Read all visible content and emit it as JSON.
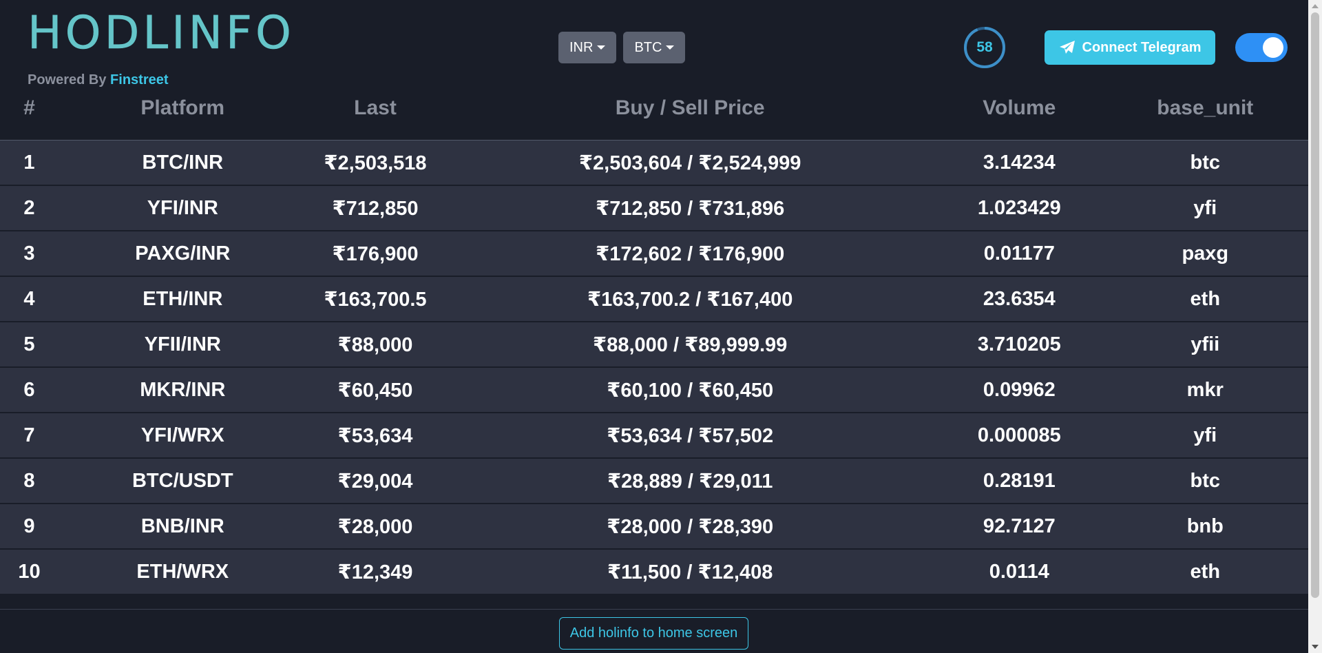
{
  "header": {
    "logo": "HODLINFO",
    "powered_by_prefix": "Powered By ",
    "powered_by_brand": "Finstreet",
    "currency_dropdown": "INR",
    "crypto_dropdown": "BTC",
    "timer_value": "58",
    "telegram_button": "Connect Telegram",
    "theme_toggle_on": true
  },
  "colors": {
    "accent": "#3dc6e6",
    "logo": "#65c5c9",
    "toggle": "#2e90f5",
    "background": "#191d28",
    "row": "#2e3241"
  },
  "table": {
    "columns": [
      "#",
      "Platform",
      "Last",
      "Buy / Sell Price",
      "Volume",
      "base_unit"
    ],
    "rows": [
      [
        "1",
        "BTC/INR",
        "₹2,503,518",
        "₹2,503,604 / ₹2,524,999",
        "3.14234",
        "btc"
      ],
      [
        "2",
        "YFI/INR",
        "₹712,850",
        "₹712,850 / ₹731,896",
        "1.023429",
        "yfi"
      ],
      [
        "3",
        "PAXG/INR",
        "₹176,900",
        "₹172,602 / ₹176,900",
        "0.01177",
        "paxg"
      ],
      [
        "4",
        "ETH/INR",
        "₹163,700.5",
        "₹163,700.2 / ₹167,400",
        "23.6354",
        "eth"
      ],
      [
        "5",
        "YFII/INR",
        "₹88,000",
        "₹88,000 / ₹89,999.99",
        "3.710205",
        "yfii"
      ],
      [
        "6",
        "MKR/INR",
        "₹60,450",
        "₹60,100 / ₹60,450",
        "0.09962",
        "mkr"
      ],
      [
        "7",
        "YFI/WRX",
        "₹53,634",
        "₹53,634 / ₹57,502",
        "0.000085",
        "yfi"
      ],
      [
        "8",
        "BTC/USDT",
        "₹29,004",
        "₹28,889 / ₹29,011",
        "0.28191",
        "btc"
      ],
      [
        "9",
        "BNB/INR",
        "₹28,000",
        "₹28,000 / ₹28,390",
        "92.7127",
        "bnb"
      ],
      [
        "10",
        "ETH/WRX",
        "₹12,349",
        "₹11,500 / ₹12,408",
        "0.0114",
        "eth"
      ]
    ]
  },
  "footer": {
    "add_button": "Add holinfo to home screen"
  },
  "icons": {
    "telegram": "telegram-icon",
    "caret": "chevron-down-icon"
  }
}
